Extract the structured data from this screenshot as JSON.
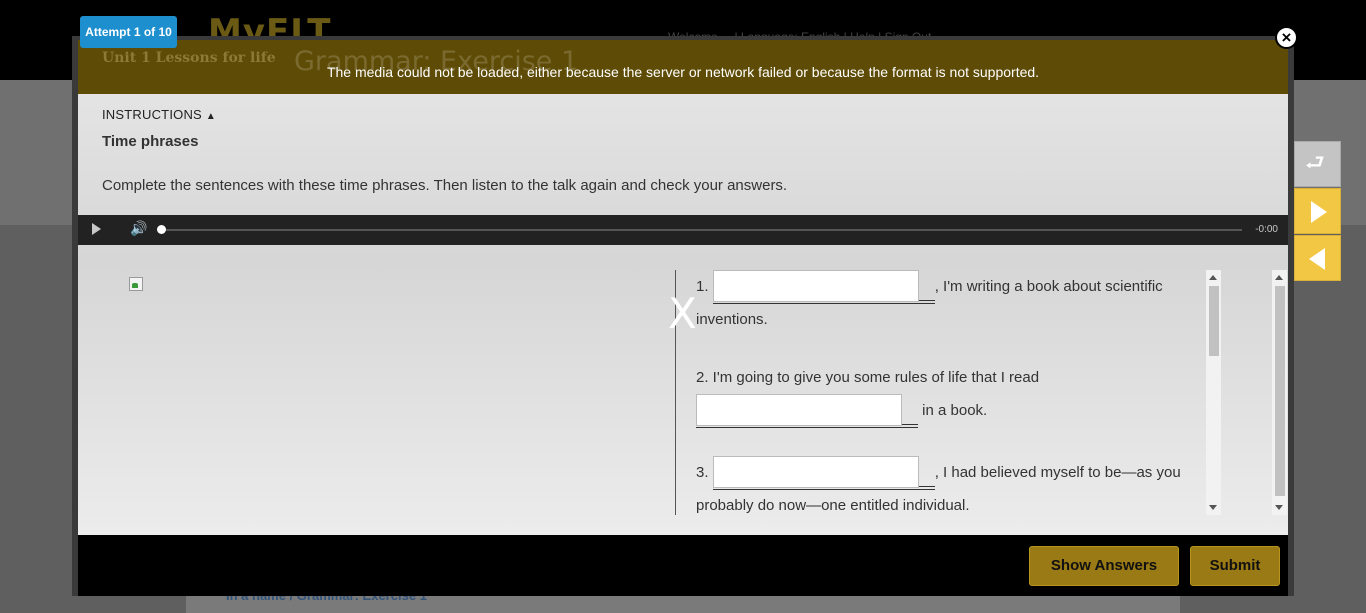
{
  "background": {
    "logo": "MyELT",
    "nav_text": "Welcome  ...  |  Language: English  |  Help  |  Sign Out",
    "breadcrumb": "In a name / Grammar: Exercise 1"
  },
  "modal": {
    "attempt_label": "Attempt 1 of 10",
    "close_symbol": "×",
    "header": {
      "unit_label": "Unit 1 Lessons for life",
      "exercise_title": "Grammar: Exercise 1",
      "media_error": "The media could not be loaded, either because the server or network failed or because the format is not supported."
    },
    "instructions": {
      "toggle_label": "INSTRUCTIONS",
      "toggle_symbol": "▲",
      "section_title": "Time phrases",
      "text": "Complete the sentences with these time phrases. Then listen to the talk again and check your answers."
    },
    "player": {
      "time": "-0:00",
      "volume_symbol": "🔊",
      "progress": 0
    },
    "divider_close": "X",
    "questions": [
      {
        "number": "1.",
        "after_blank": ", I'm writing a book about scientific",
        "line2": "inventions."
      },
      {
        "line1": "2. I'm going to give you some rules of life that I read",
        "after_blank": "in a book."
      },
      {
        "number": "3.",
        "after_blank": ", I had believed myself to be—as you",
        "line2": "probably do now—one entitled individual."
      }
    ],
    "buttons": {
      "show_answers": "Show Answers",
      "submit": "Submit"
    }
  },
  "side_nav": {
    "reset_symbol": "⮐"
  },
  "colors": {
    "accent": "#9a7a14",
    "attempt_badge": "#1d8ece",
    "side_arrow": "#f2c744"
  }
}
